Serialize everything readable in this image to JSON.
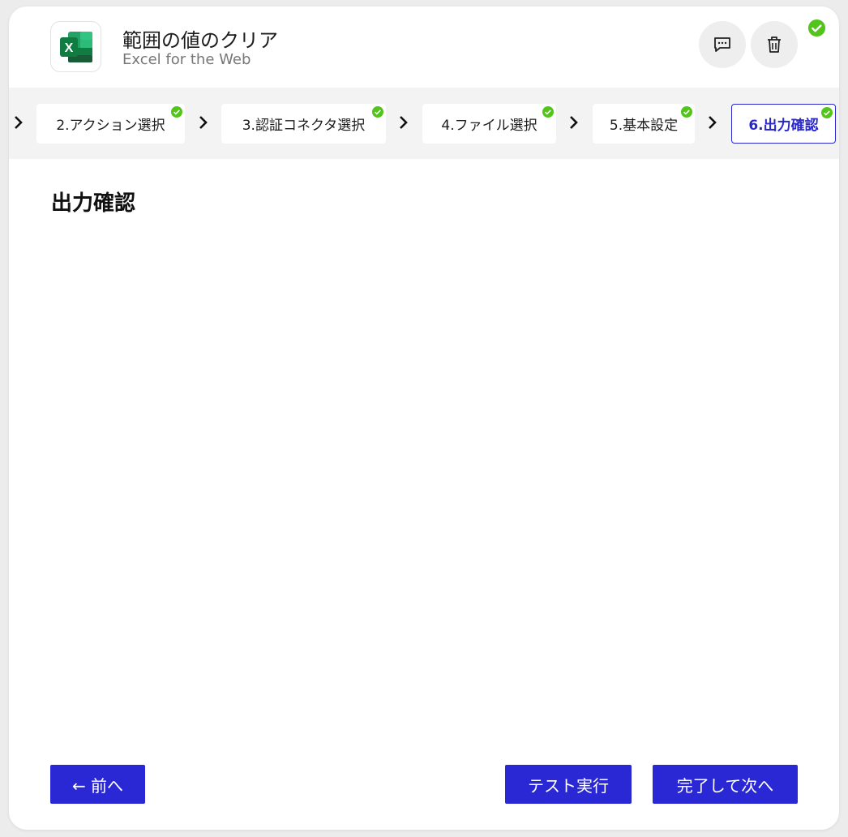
{
  "header": {
    "title": "範囲の値のクリア",
    "subtitle": "Excel for the Web",
    "app_icon": "excel-icon",
    "actions": [
      {
        "icon": "comment-icon"
      },
      {
        "icon": "trash-icon"
      }
    ],
    "status_icon": "check-circle-icon",
    "colors": {
      "success": "#52c41a",
      "excel_dark": "#1d6f42",
      "excel_light": "#33c481"
    }
  },
  "steps": [
    {
      "label": "2.アクション選択",
      "done": true
    },
    {
      "label": "3.認証コネクタ選択",
      "done": true
    },
    {
      "label": "4.ファイル選択",
      "done": true
    },
    {
      "label": "5.基本設定",
      "done": true
    },
    {
      "label": "6.出力確認",
      "done": true,
      "active": true
    }
  ],
  "main": {
    "section_title": "出力確認"
  },
  "footer": {
    "prev_label": "← 前へ",
    "test_label": "テスト実行",
    "next_label": "完了して次へ",
    "button_color": "#2a28d4"
  }
}
